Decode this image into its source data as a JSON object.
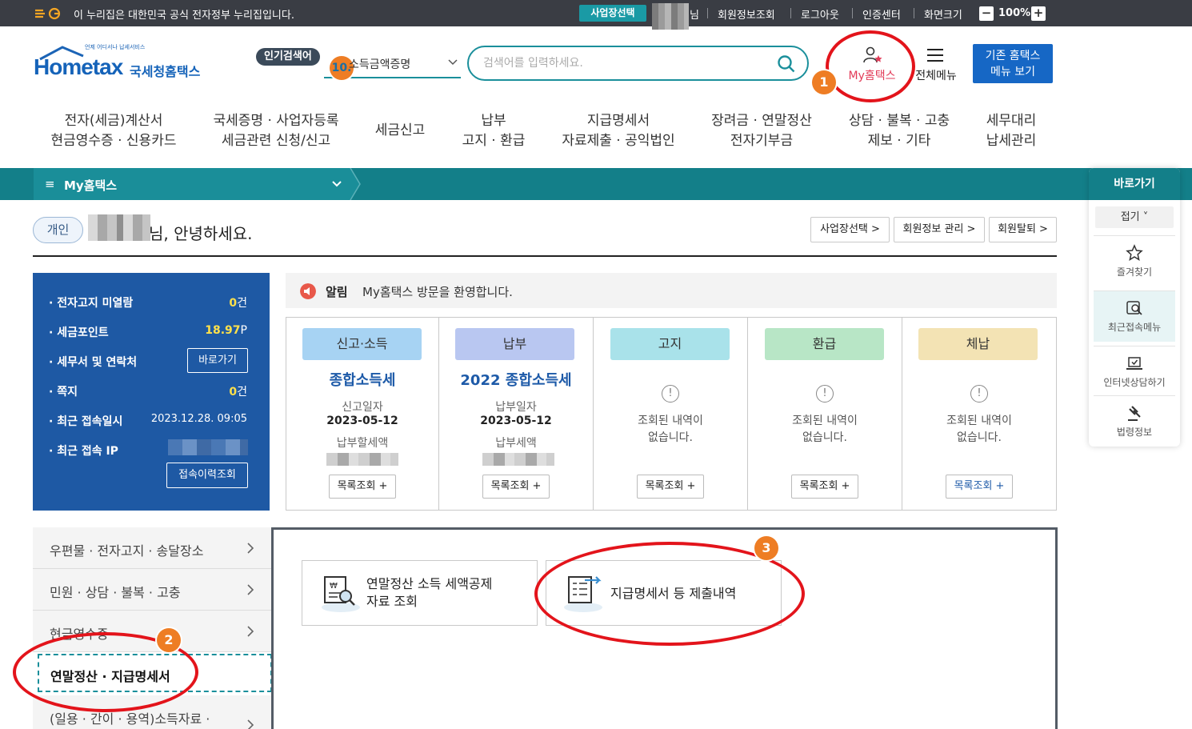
{
  "gov_bar": {
    "notice": "이 누리집은 대한민국 공식 전자정부 누리집입니다.",
    "business_select": "사업장선택",
    "name_suffix": "님",
    "links": [
      "회원정보조회",
      "로그아웃",
      "인증센터",
      "화면크기"
    ],
    "zoom_minus": "−",
    "zoom_level": "100%",
    "zoom_plus": "+"
  },
  "logo": {
    "small_text": "언제 어디서나 납세서비스",
    "brand": "Hometax",
    "korean": "국세청홈택스"
  },
  "search": {
    "popular_label": "인기검색어",
    "keyword_rank": "10.",
    "keyword_text": "소득금액증명",
    "placeholder": "검색어를 입력하세요."
  },
  "header": {
    "my_hometax": "My홈택스",
    "all_menu": "전체메뉴",
    "old_hometax_line1": "기존 홈택스",
    "old_hometax_line2": "메뉴 보기"
  },
  "gnb": [
    {
      "line1": "전자(세금)계산서",
      "line2": "현금영수증 · 신용카드"
    },
    {
      "line1": "국세증명 · 사업자등록",
      "line2": "세금관련 신청/신고"
    },
    {
      "line1": "세금신고",
      "line2": ""
    },
    {
      "line1": "납부",
      "line2": "고지 · 환급"
    },
    {
      "line1": "지급명세서",
      "line2": "자료제출 · 공익법인"
    },
    {
      "line1": "장려금 · 연말정산",
      "line2": "전자기부금"
    },
    {
      "line1": "상담 · 불복 · 고충",
      "line2": "제보 · 기타"
    },
    {
      "line1": "세무대리",
      "line2": "납세관리"
    }
  ],
  "section_bar": {
    "hamburger": "≡",
    "title": "My홈택스"
  },
  "greeting": {
    "type_badge": "개인",
    "text": "님, 안녕하세요.",
    "buttons": [
      "사업장선택 >",
      "회원정보 관리 >",
      "회원탈퇴 >"
    ]
  },
  "info": {
    "rows": [
      {
        "label": "· 전자고지 미열람",
        "value": "0",
        "unit": "건"
      },
      {
        "label": "· 세금포인트",
        "value": "18.97",
        "unit": "P"
      },
      {
        "label": "· 세무서 및 연락처",
        "button": "바로가기"
      },
      {
        "label": "· 쪽지",
        "value": "0",
        "unit": "건"
      },
      {
        "label": "· 최근 접속일시",
        "date": "2023.12.28.  09:05"
      },
      {
        "label": "· 최근 접속 IP",
        "button": "접속이력조회"
      }
    ]
  },
  "alert": {
    "label": "알림",
    "message": "My홈택스 방문을 환영합니다."
  },
  "cards": [
    {
      "tag": "신고·소득",
      "tag_color": "#a7d3f3",
      "title": "종합소득세",
      "date_label": "신고일자",
      "date": "2023-05-12",
      "amount_label": "납부할세액",
      "button": "목록조회 +"
    },
    {
      "tag": "납부",
      "tag_color": "#b9c7f1",
      "title": "2022 종합소득세",
      "date_label": "납부일자",
      "date": "2023-05-12",
      "amount_label": "납부세액",
      "button": "목록조회 +"
    },
    {
      "tag": "고지",
      "tag_color": "#a9e2ea",
      "empty_line1": "조회된 내역이",
      "empty_line2": "없습니다.",
      "button": "목록조회 +"
    },
    {
      "tag": "환급",
      "tag_color": "#b8e6c6",
      "empty_line1": "조회된 내역이",
      "empty_line2": "없습니다.",
      "button": "목록조회 +"
    },
    {
      "tag": "체납",
      "tag_color": "#f3e3b4",
      "empty_line1": "조회된 내역이",
      "empty_line2": "없습니다.",
      "button": "목록조회 +"
    }
  ],
  "left_menu": [
    "우편물 · 전자고지 · 송달장소",
    "민원 · 상담 · 불복 · 고충",
    "현금영수증",
    "연말정산 · 지급명세서",
    "(일용 · 간이 · 용역)소득자료 ·"
  ],
  "content": {
    "button1_line1": "연말정산 소득 세액공제",
    "button1_line2": "자료 조회",
    "button2": "지급명세서 등 제출내역"
  },
  "quick": {
    "title": "바로가기",
    "fold": "접기 ˅",
    "items": [
      "즐겨찾기",
      "최근접속메뉴",
      "인터넷상담하기",
      "법령정보"
    ]
  },
  "annotations": [
    "1",
    "2",
    "3"
  ],
  "colors": {
    "teal": "#137f89",
    "info_blue": "#1e59a4",
    "annotation_red": "#e3141b",
    "annotation_orange": "#ee7d24"
  }
}
